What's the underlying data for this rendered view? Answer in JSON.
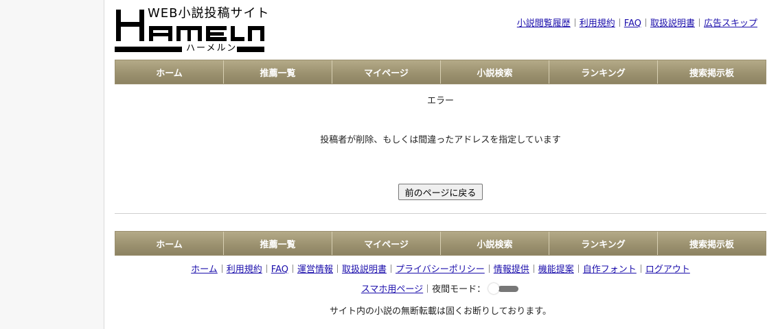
{
  "logo": {
    "tagline": "WEB小説投稿サイト",
    "wordmark": "HAMELN",
    "kana": "ハーメルン"
  },
  "header_links": [
    "小説閲覧履歴",
    "利用規約",
    "FAQ",
    "取扱説明書",
    "広告スキップ"
  ],
  "nav": [
    "ホーム",
    "推薦一覧",
    "マイページ",
    "小説検索",
    "ランキング",
    "捜索掲示板"
  ],
  "main": {
    "error_title": "エラー",
    "error_message": "投稿者が削除、もしくは間違ったアドレスを指定しています",
    "back_button": "前のページに戻る"
  },
  "footer": {
    "links": [
      "ホーム",
      "利用規約",
      "FAQ",
      "運営情報",
      "取扱説明書",
      "プライバシーポリシー",
      "情報提供",
      "機能提案",
      "自作フォント",
      "ログアウト"
    ],
    "mobile_link": "スマホ用ページ",
    "night_mode_label": "夜間モード：",
    "night_mode_on": false,
    "copyright": "サイト内の小説の無断転載は固くお断りしております。"
  },
  "colors": {
    "nav_bar": "#9c9270",
    "link": "#1a0dab",
    "toggle_track": "#777777"
  }
}
